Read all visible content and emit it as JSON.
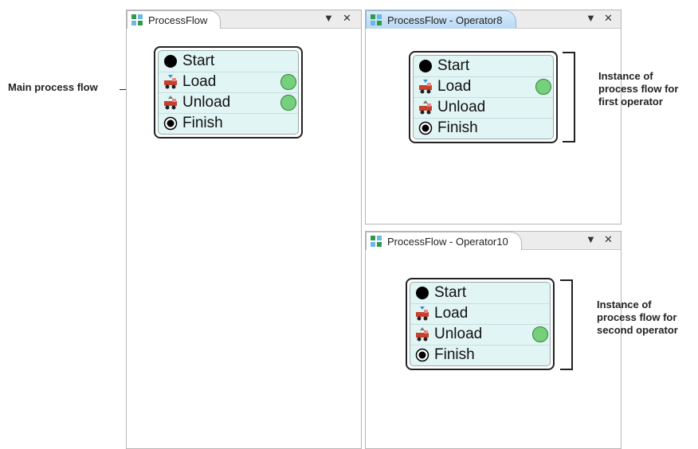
{
  "annotations": {
    "main": "Main process flow",
    "op8": "Instance of\nprocess flow for\nfirst operator",
    "op10": "Instance of\nprocess flow for\nsecond operator"
  },
  "panels": [
    {
      "tab": "ProcessFlow",
      "menu_glyph": "▼",
      "close_glyph": "✕"
    },
    {
      "tab": "ProcessFlow - Operator8",
      "menu_glyph": "▼",
      "close_glyph": "✕"
    },
    {
      "tab": "ProcessFlow - Operator10",
      "menu_glyph": "▼",
      "close_glyph": "✕"
    }
  ],
  "flow_steps": [
    "Start",
    "Load",
    "Unload",
    "Finish"
  ],
  "flows": {
    "main": {
      "tokens_on": [
        "Load",
        "Unload"
      ]
    },
    "op8": {
      "tokens_on": [
        "Load"
      ]
    },
    "op10": {
      "tokens_on": [
        "Unload"
      ]
    }
  },
  "colors": {
    "flow_bg": "#e1f5f4",
    "token": "#74d07a",
    "active_tab": "#b9d8f4"
  },
  "icons": {
    "tab": "process-flow-icon",
    "start": "black-circle-icon",
    "load": "load-truck-icon",
    "unload": "unload-truck-icon",
    "finish": "target-circle-icon"
  }
}
